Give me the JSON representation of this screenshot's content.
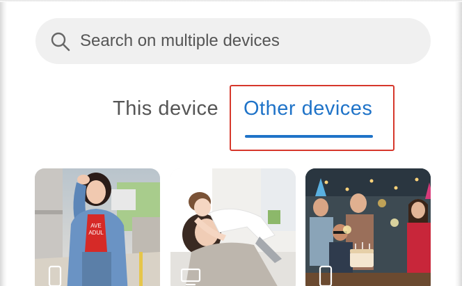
{
  "search": {
    "placeholder": "Search on multiple devices",
    "icon": "search-icon"
  },
  "tabs": [
    {
      "label": "This device",
      "selected": false
    },
    {
      "label": "Other devices",
      "selected": true
    }
  ],
  "colors": {
    "accent": "#1f73c8",
    "highlight_box": "#d6372b",
    "search_background": "#f0f0f0"
  },
  "photos": [
    {
      "scene": "woman-in-denim-jacket-street",
      "device_icon": "phone-icon"
    },
    {
      "scene": "mother-and-daughter-hug-bedroom",
      "device_icon": "tv-icon"
    },
    {
      "scene": "friends-birthday-party-cake",
      "device_icon": "phone-icon"
    }
  ]
}
